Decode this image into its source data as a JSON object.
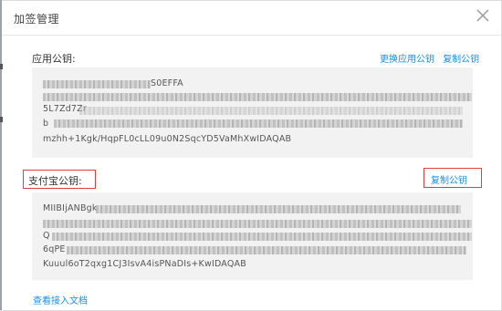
{
  "dialog": {
    "title": "加签管理"
  },
  "app_key": {
    "label": "应用公钥:",
    "replace_label": "更换应用公钥",
    "copy_label": "复制公钥",
    "lines": [
      "S0EFFA",
      "",
      "5L7Zd7Zr",
      "b",
      "mzhh+1Kgk/HqpFL0cLL09u0N2SqcYD5VaMhXwIDAQAB"
    ]
  },
  "alipay_key": {
    "label": "支付宝公钥:",
    "copy_label": "复制公钥",
    "lines": [
      "MIIBIjANBgk",
      "",
      "Q",
      "6qPE",
      "Kuuul6oT2qxg1CJ3IsvA4isPNaDIs+KwIDAQAB"
    ]
  },
  "footer": {
    "doc_link": "查看接入文档"
  },
  "colors": {
    "link": "#1a8ee6",
    "highlight": "#e43b3b",
    "box": "#f2f2f2"
  }
}
